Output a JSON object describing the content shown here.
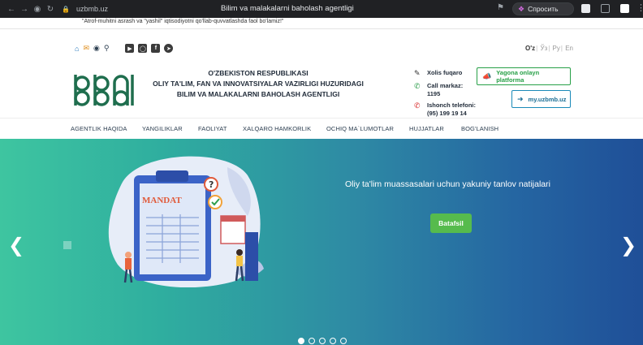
{
  "browser": {
    "url": "uzbmb.uz",
    "tab_title": "Bilim va malakalarni baholash agentligi",
    "ask_label": "Спросить"
  },
  "header": {
    "slogan": "\"Atrof-muhitni asrash va \"yashil\" iqtisodiyotni qo'llab-quvvatlashda faol bo'lamiz!\"",
    "languages": [
      "O'z",
      "Ўз",
      "Ру",
      "En"
    ],
    "org_lines": [
      "O'ZBEKISTON RESPUBLIKASI",
      "OLIY TA'LIM, FAN VA INNOVATSIYALAR VAZIRLIGI HUZURIDAGI",
      "BILIM VA MALAKALARNI BAHOLASH AGENTLIGI"
    ],
    "contacts": {
      "xolis": "Xolis fuqaro",
      "call_center_label": "Call markaz:",
      "call_center_number": "1195",
      "trust_label": "Ishonch telefoni:",
      "trust_number": "(95) 199 19 14"
    },
    "platform_btn": "Yagona onlayn platforma",
    "login_btn": "my.uzbmb.uz"
  },
  "menu": [
    "AGENTLIK HAQIDA",
    "YANGILIKLAR",
    "FAOLIYAT",
    "XALQARO HAMKORLIK",
    "OCHIQ MA`LUMOTLAR",
    "HUJJATLAR",
    "BOG'LANISH"
  ],
  "hero": {
    "caption": "Oliy ta'lim muassasalari uchun yakuniy tanlov natijalari",
    "button": "Batafsil",
    "illustration_text": "MANDAT",
    "slide_count": 5,
    "active_slide": 0
  },
  "colors": {
    "accent_green": "#27a047",
    "accent_blue": "#1a8ab8",
    "logo_green": "#1f6e4e"
  }
}
